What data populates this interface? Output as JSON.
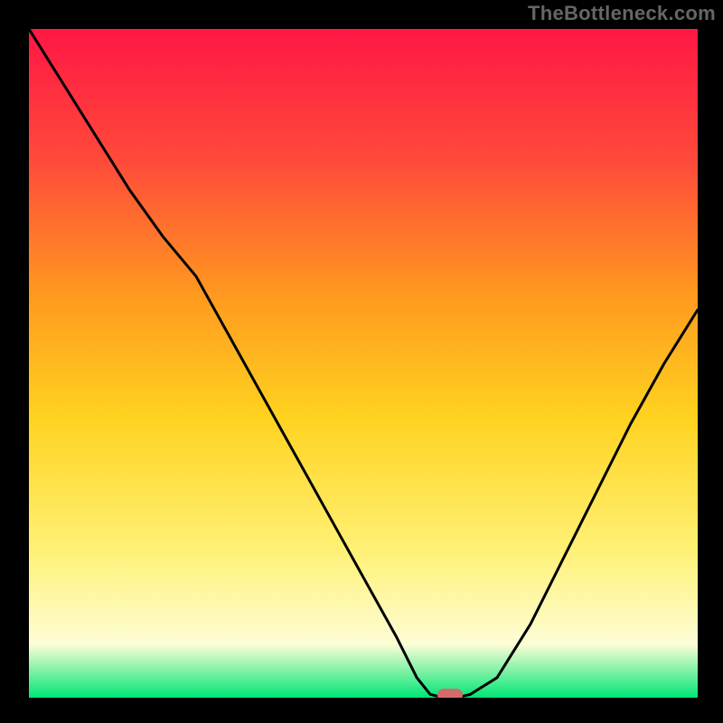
{
  "watermark": "TheBottleneck.com",
  "colors": {
    "frame": "#000000",
    "line": "#000000",
    "grad_top": "#ff1744",
    "grad_upper": "#ff4b3a",
    "grad_mid_upper": "#ff9a1f",
    "grad_mid": "#ffd21f",
    "grad_lower": "#fff176",
    "grad_pale": "#fdfdd6",
    "grad_base": "#00e676",
    "marker": "#d46a6a"
  },
  "chart_data": {
    "type": "line",
    "title": "",
    "xlabel": "",
    "ylabel": "",
    "xlim": [
      0,
      100
    ],
    "ylim": [
      0,
      100
    ],
    "x": [
      0,
      5,
      10,
      15,
      20,
      25,
      30,
      35,
      40,
      45,
      50,
      55,
      58,
      60,
      62,
      64,
      66,
      70,
      75,
      80,
      85,
      90,
      95,
      100
    ],
    "values": [
      100,
      92,
      84,
      76,
      69,
      63,
      54,
      45,
      36,
      27,
      18,
      9,
      3,
      0.5,
      0,
      0,
      0.5,
      3,
      11,
      21,
      31,
      41,
      50,
      58
    ],
    "optimum_x": 63,
    "optimum_y": 0,
    "marker": {
      "x": 63,
      "y": 0
    }
  }
}
